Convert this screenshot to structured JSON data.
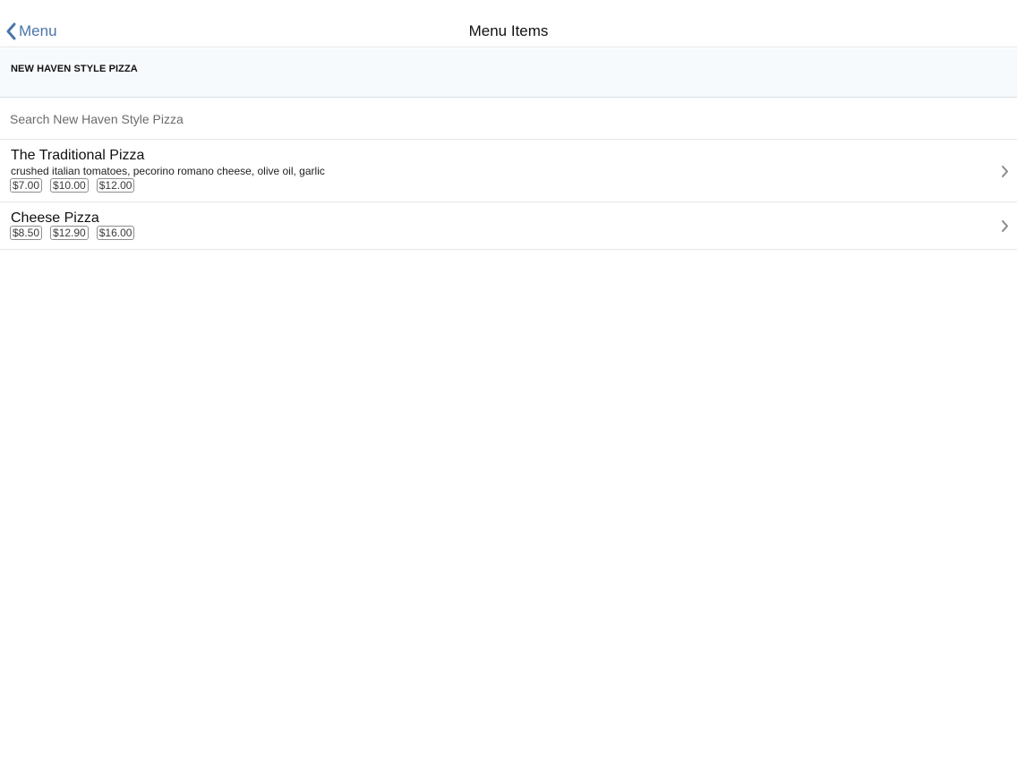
{
  "nav": {
    "back_label": "Menu",
    "title": "Menu Items"
  },
  "section": {
    "title": "NEW HAVEN STYLE PIZZA"
  },
  "search": {
    "placeholder": "Search New Haven Style Pizza",
    "value": ""
  },
  "items": [
    {
      "name": "The Traditional Pizza",
      "description": "crushed italian tomatoes, pecorino romano cheese, olive oil, garlic",
      "prices": [
        "$7.00",
        "$10.00",
        "$12.00"
      ]
    },
    {
      "name": "Cheese Pizza",
      "description": "",
      "prices": [
        "$8.50",
        "$12.90",
        "$16.00"
      ]
    }
  ],
  "colors": {
    "accent": "#4a76a8",
    "section_bg": "#f7fafd",
    "divider": "#e4e6ea"
  },
  "icons": {
    "back": "chevron-left-icon",
    "disclosure": "chevron-right-icon"
  }
}
